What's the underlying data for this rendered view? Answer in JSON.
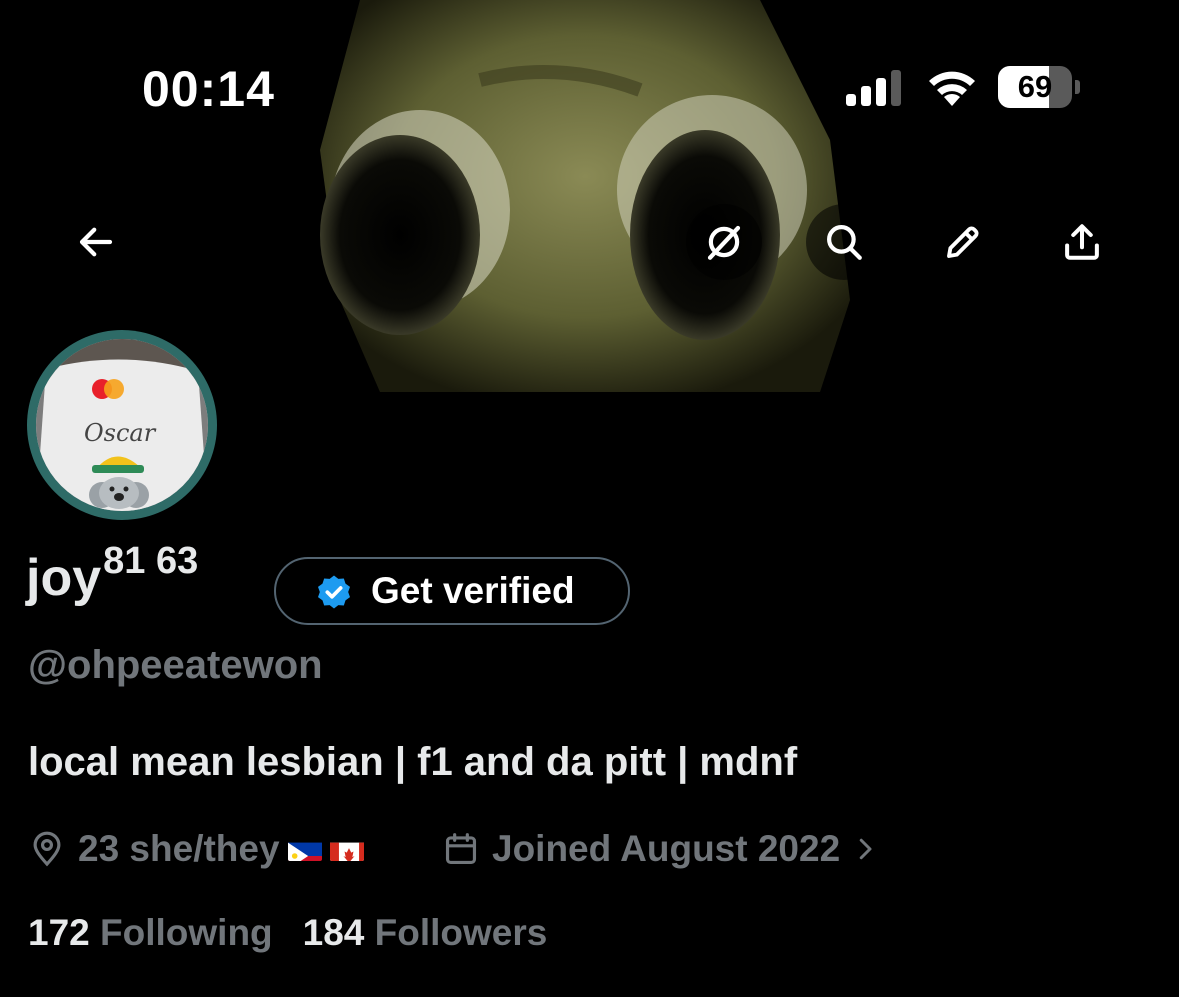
{
  "status_bar": {
    "time": "00:14",
    "battery_level": "69",
    "battery_fraction": 0.69,
    "signal_icon": "cellular-signal-icon",
    "wifi_icon": "wifi-icon"
  },
  "header_nav": {
    "back_icon": "back-arrow-icon",
    "grok_icon": "grok-icon",
    "search_icon": "search-icon",
    "edit_icon": "pencil-icon",
    "share_icon": "share-icon"
  },
  "profile": {
    "display_name": "joy",
    "display_name_superscript": "81 63",
    "verify_button_label": "Get verified",
    "handle": "@ohpeeatewon",
    "bio": "local mean lesbian | f1 and da pitt | mdnf",
    "location": "23 she/they",
    "joined": "Joined August 2022",
    "following_count": "172",
    "following_label": "Following",
    "followers_count": "184",
    "followers_label": "Followers",
    "avatar_shirt_text": "Oscar"
  },
  "colors": {
    "background": "#000000",
    "text_primary": "#e7e9ea",
    "text_secondary": "#71767b",
    "verified_blue": "#1d9bf0",
    "avatar_ring": "#2e6b67"
  }
}
